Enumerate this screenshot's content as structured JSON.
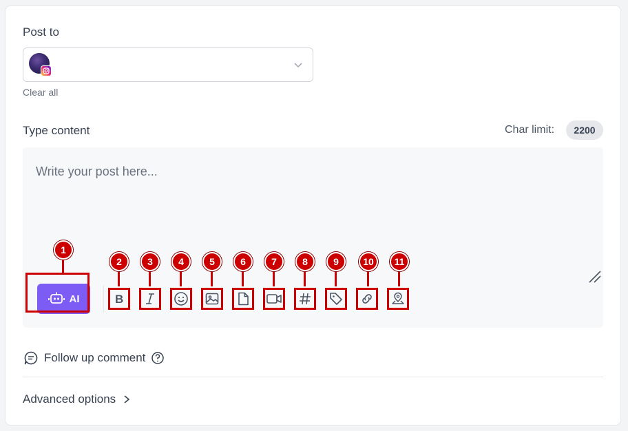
{
  "post_to": {
    "label": "Post to",
    "selected_account": {
      "avatar": "purple-space-avatar",
      "platform_icon": "instagram-icon"
    },
    "dropdown_icon": "chevron-down-icon",
    "clear_all": "Clear all"
  },
  "content": {
    "label": "Type content",
    "char_limit_label": "Char limit:",
    "char_limit_value": "2200",
    "placeholder": "Write your post here...",
    "ai_button_label": "AI",
    "toolbar": [
      {
        "id": "bold",
        "icon": "bold-icon"
      },
      {
        "id": "italic",
        "icon": "italic-icon"
      },
      {
        "id": "emoji",
        "icon": "emoji-icon"
      },
      {
        "id": "image",
        "icon": "image-icon"
      },
      {
        "id": "document",
        "icon": "document-icon"
      },
      {
        "id": "video",
        "icon": "video-icon"
      },
      {
        "id": "hashtag",
        "icon": "hashtag-icon"
      },
      {
        "id": "tag",
        "icon": "tag-icon"
      },
      {
        "id": "link",
        "icon": "link-icon"
      },
      {
        "id": "location",
        "icon": "location-icon"
      }
    ]
  },
  "annotations": [
    "1",
    "2",
    "3",
    "4",
    "5",
    "6",
    "7",
    "8",
    "9",
    "10",
    "11"
  ],
  "follow_up": {
    "label": "Follow up comment",
    "icon": "chat-icon",
    "help_icon": "question-circle-icon"
  },
  "advanced": {
    "label": "Advanced options",
    "icon": "chevron-right-icon"
  },
  "colors": {
    "accent": "#7c5cf5",
    "annotation_red": "#cc0000"
  }
}
